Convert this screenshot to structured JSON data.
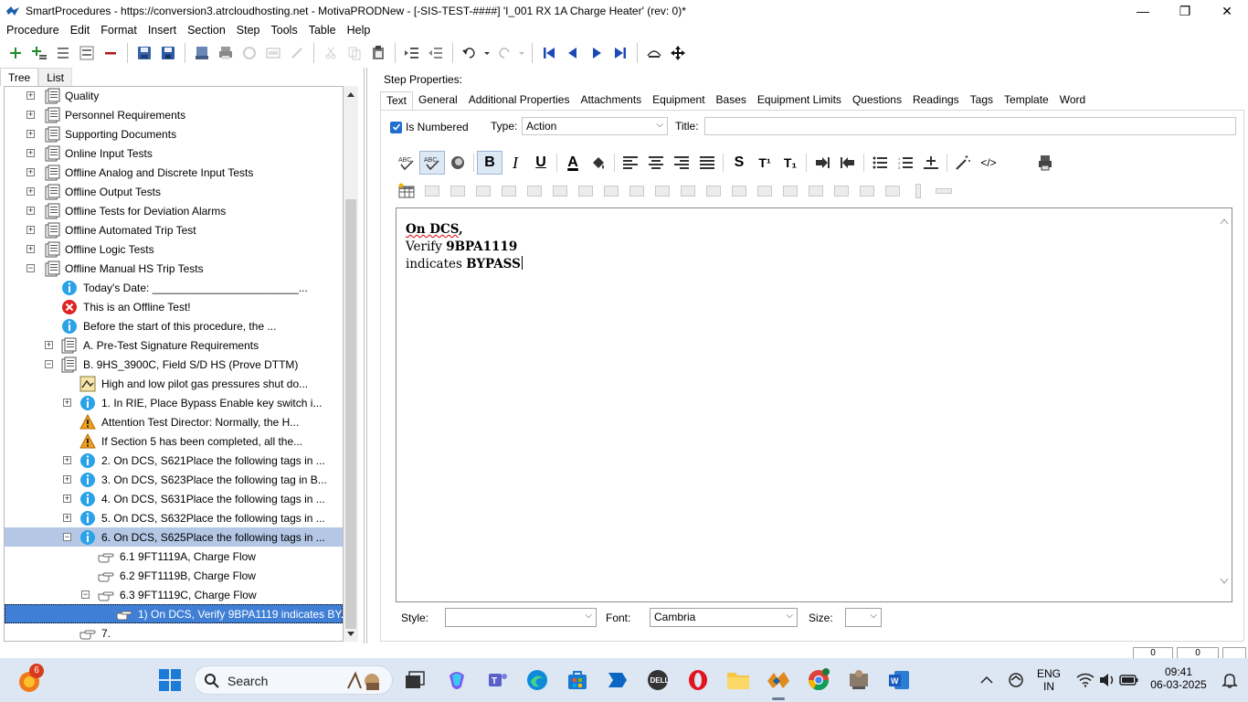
{
  "window": {
    "title": "SmartProcedures - https://conversion3.atrcloudhosting.net - MotivaPRODNew - [-SIS-TEST-####] 'I_001 RX 1A Charge Heater' (rev: 0)*",
    "minimize": "—",
    "maximize": "❐",
    "close": "✕"
  },
  "menu": [
    "Procedure",
    "Edit",
    "Format",
    "Insert",
    "Section",
    "Step",
    "Tools",
    "Table",
    "Help"
  ],
  "left_tabs": [
    "Tree",
    "List"
  ],
  "tree": [
    {
      "label": "Quality"
    },
    {
      "label": "Personnel Requirements"
    },
    {
      "label": "Supporting Documents"
    },
    {
      "label": "Online Input Tests"
    },
    {
      "label": "Offline Analog and Discrete Input Tests"
    },
    {
      "label": "Offline Output Tests"
    },
    {
      "label": "Offline Tests for Deviation Alarms"
    },
    {
      "label": "Offline Automated Trip Test"
    },
    {
      "label": "Offline Logic Tests"
    },
    {
      "label": "Offline Manual HS Trip Tests"
    },
    {
      "label": "Today's Date: ________________________..."
    },
    {
      "label": "This is an Offline Test!"
    },
    {
      "label": "Before the start of this procedure, the ..."
    },
    {
      "label": "A. Pre-Test Signature Requirements"
    },
    {
      "label": "B. 9HS_3900C, Field S/D HS (Prove DTTM)"
    },
    {
      "label": "High and low pilot gas pressures shut do..."
    },
    {
      "label": "1. In RIE, Place Bypass Enable key switch i..."
    },
    {
      "label": "Attention Test Director: Normally, the H..."
    },
    {
      "label": "If Section 5 has been completed, all the..."
    },
    {
      "label": "2. On DCS, S621Place the following tags in ..."
    },
    {
      "label": "3. On DCS, S623Place the following tag in B..."
    },
    {
      "label": "4. On DCS, S631Place the following tags in ..."
    },
    {
      "label": "5. On DCS, S632Place the following tags in ..."
    },
    {
      "label": "6. On DCS, S625Place the following tags in ..."
    },
    {
      "label": "6.1 9FT1119A, Charge Flow"
    },
    {
      "label": "6.2 9FT1119B, Charge Flow"
    },
    {
      "label": "6.3 9FT1119C, Charge Flow"
    },
    {
      "label": "1) On DCS, Verify 9BPA1119  indicates BY..."
    },
    {
      "label": "7."
    }
  ],
  "step_properties": {
    "heading": "Step Properties:",
    "tabs": [
      "Text",
      "General",
      "Additional Properties",
      "Attachments",
      "Equipment",
      "Bases",
      "Equipment Limits",
      "Questions",
      "Readings",
      "Tags",
      "Template",
      "Word"
    ],
    "is_numbered_label": "Is Numbered",
    "is_numbered": true,
    "type_label": "Type:",
    "type_value": "Action",
    "title_label": "Title:",
    "title_value": ""
  },
  "format_toolbar": {
    "bold": "B",
    "italic": "I",
    "underline": "U",
    "font_color": "A",
    "strike": "S",
    "superscript": "T¹",
    "subscript": "T₁",
    "source": "</>"
  },
  "editor": {
    "line1_bold": "On DCS",
    "line1_tail": ",",
    "line2_prefix": "Verify ",
    "line2_bold": "9BPA1119",
    "line3_prefix": "indicates ",
    "line3_bold": "BYPASS"
  },
  "style_row": {
    "style_label": "Style:",
    "style_value": "",
    "font_label": "Font:",
    "font_value": "Cambria",
    "size_label": "Size:",
    "size_value": ""
  },
  "status": {
    "box1": "0",
    "box2": "0"
  },
  "taskbar": {
    "notification_count": "6",
    "search_placeholder": "Search",
    "lang_line1": "ENG",
    "lang_line2": "IN",
    "time": "09:41",
    "date": "06-03-2025"
  }
}
